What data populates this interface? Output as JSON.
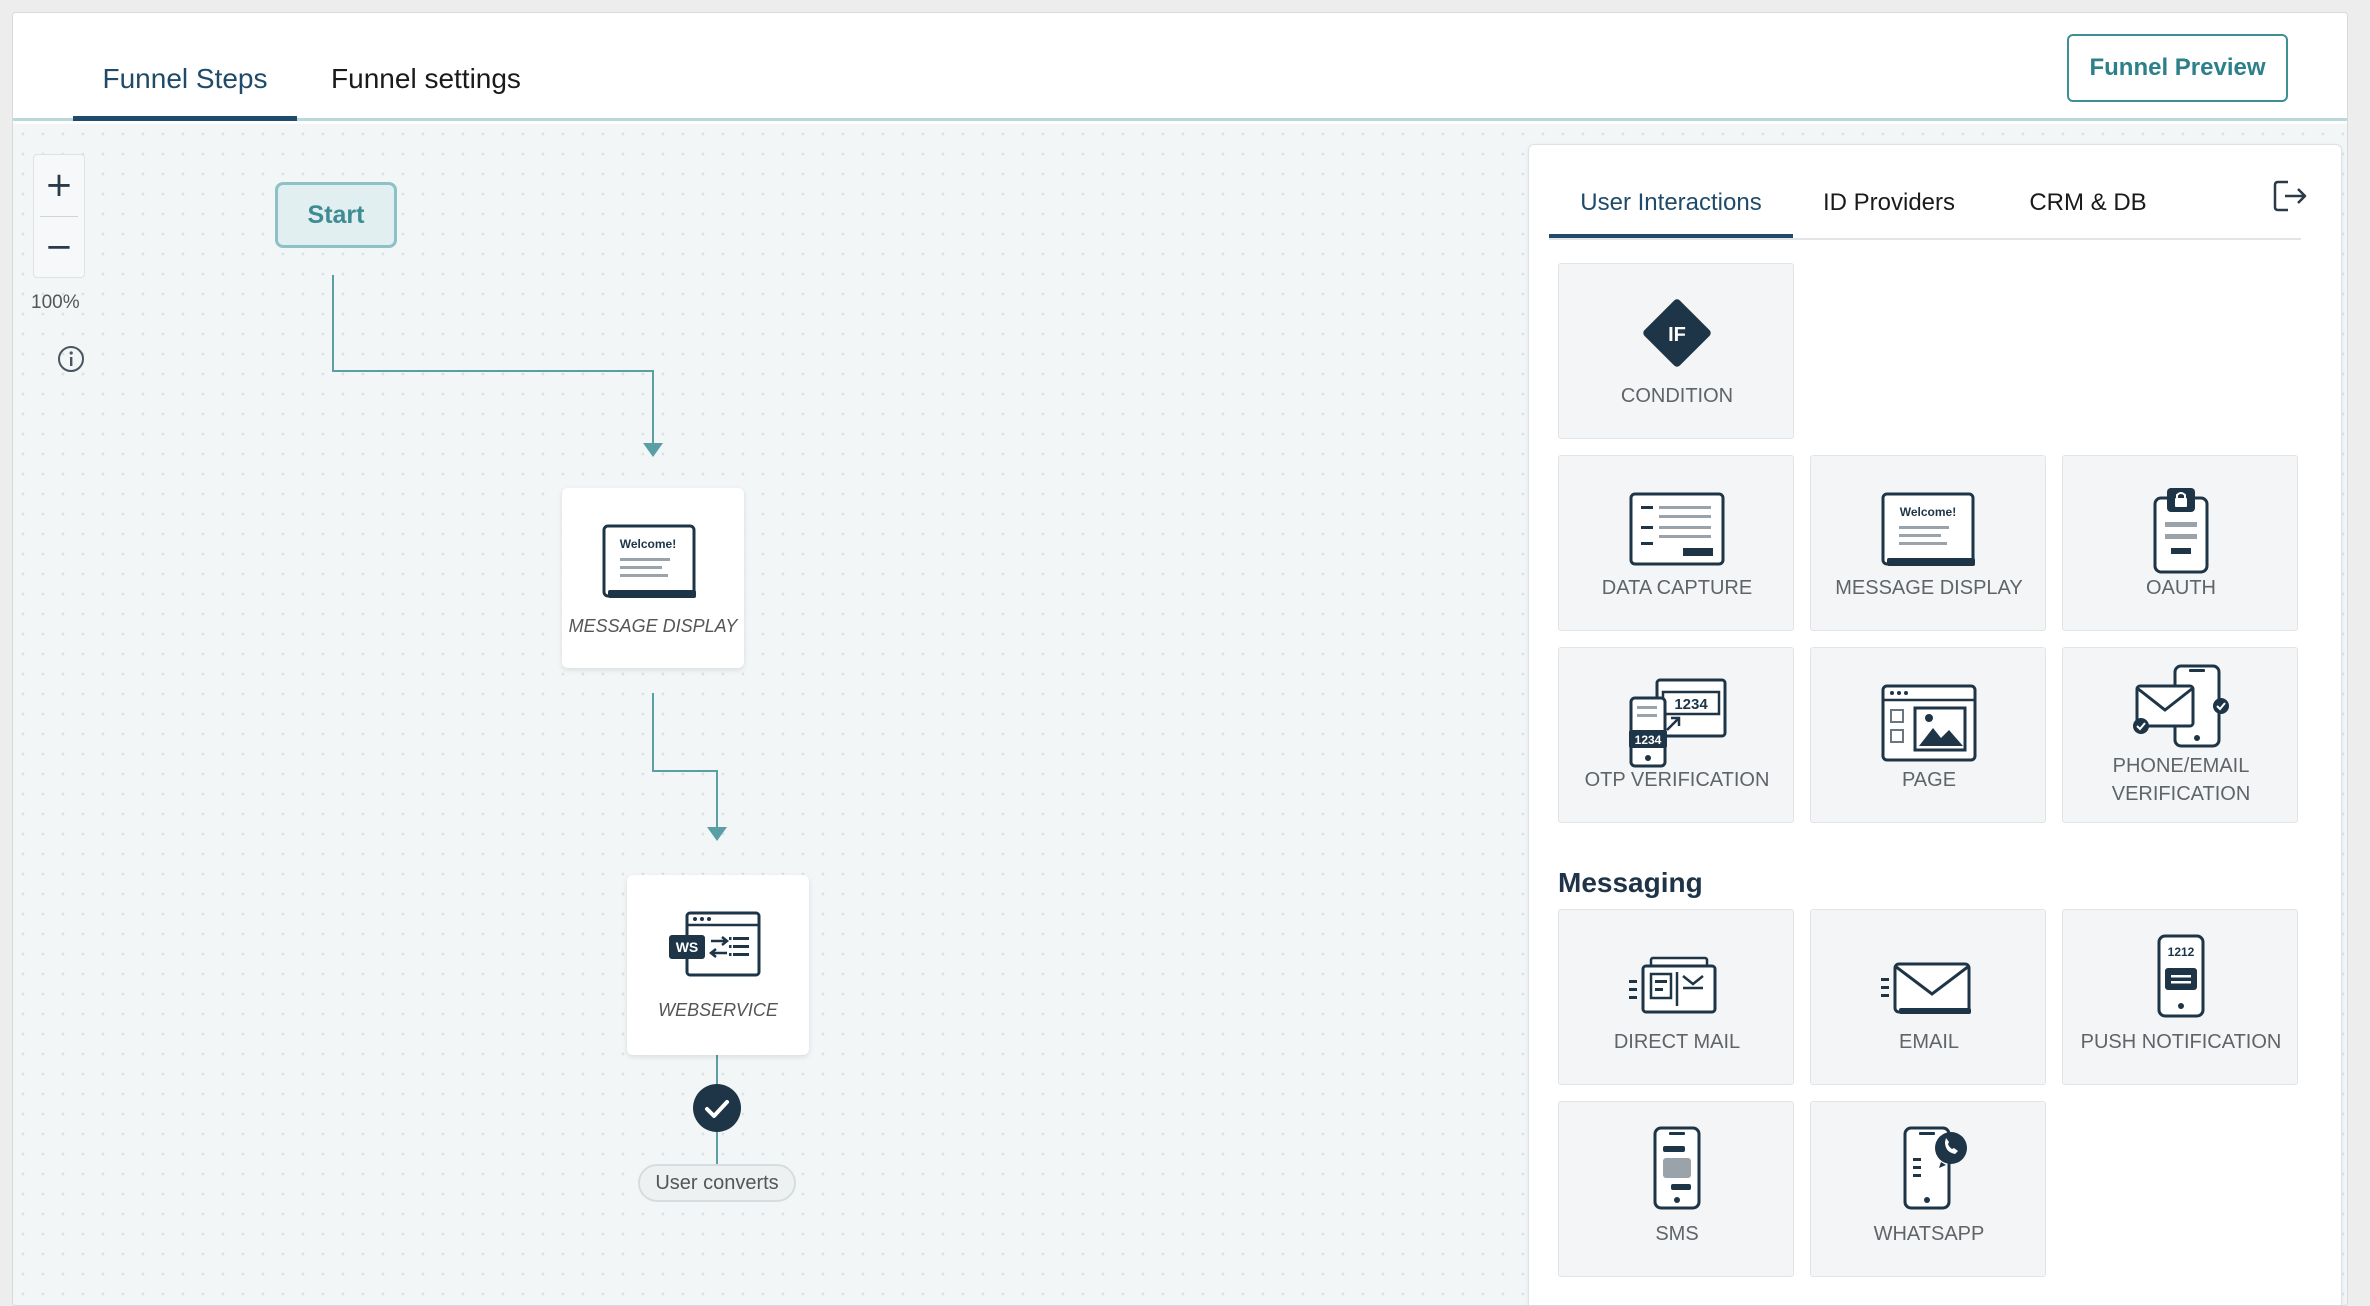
{
  "header": {
    "tabs": [
      {
        "label": "Funnel Steps",
        "active": true
      },
      {
        "label": "Funnel settings",
        "active": false
      }
    ],
    "preview_button": "Funnel Preview"
  },
  "canvas": {
    "zoom_in": "+",
    "zoom_out": "−",
    "zoom_level": "100%",
    "start_label": "Start",
    "nodes": [
      {
        "label": "MESSAGE DISPLAY",
        "icon": "message-display-icon",
        "icon_text": "Welcome!"
      },
      {
        "label": "WEBSERVICE",
        "icon": "webservice-icon",
        "icon_text": "WS"
      }
    ],
    "end_label": "User converts"
  },
  "panel": {
    "tabs": [
      {
        "label": "User Interactions",
        "active": true
      },
      {
        "label": "ID Providers",
        "active": false
      },
      {
        "label": "CRM & DB",
        "active": false
      }
    ],
    "condition": {
      "label": "CONDITION",
      "icon_text": "IF"
    },
    "interactions": [
      {
        "label": "DATA CAPTURE",
        "icon": "data-capture-icon"
      },
      {
        "label": "MESSAGE DISPLAY",
        "icon": "message-display-icon",
        "icon_text": "Welcome!"
      },
      {
        "label": "OAUTH",
        "icon": "oauth-icon"
      },
      {
        "label": "OTP VERIFICATION",
        "icon": "otp-verification-icon",
        "icon_text": "1234"
      },
      {
        "label": "PAGE",
        "icon": "page-icon"
      },
      {
        "label": "PHONE/EMAIL VERIFICATION",
        "icon": "phone-email-verification-icon"
      }
    ],
    "messaging_title": "Messaging",
    "messaging": [
      {
        "label": "DIRECT MAIL",
        "icon": "direct-mail-icon"
      },
      {
        "label": "EMAIL",
        "icon": "email-icon"
      },
      {
        "label": "PUSH NOTIFICATION",
        "icon": "push-notification-icon",
        "icon_text": "1212"
      },
      {
        "label": "SMS",
        "icon": "sms-icon"
      },
      {
        "label": "WHATSAPP",
        "icon": "whatsapp-icon"
      }
    ]
  },
  "colors": {
    "accent": "#1f4b6b",
    "teal": "#3f8f97",
    "icon_dark": "#1e3547",
    "connector": "#5a9ea6"
  }
}
